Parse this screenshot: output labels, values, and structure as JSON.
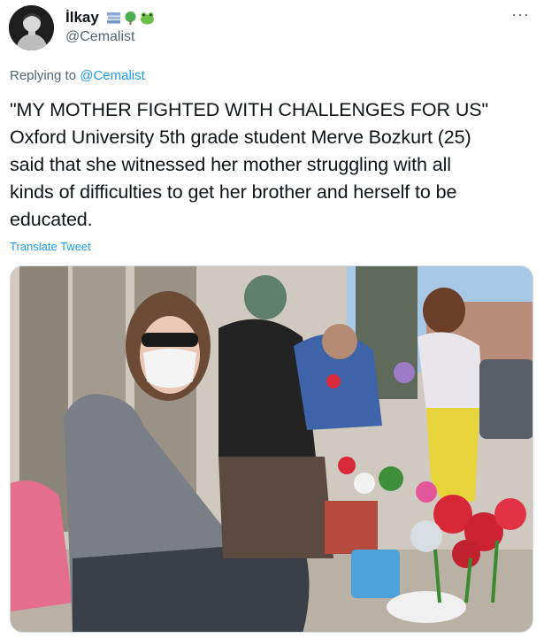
{
  "author": {
    "display_name": "İlkay",
    "handle": "@Cemalist",
    "emojis": [
      "books-emoji",
      "tree-emoji",
      "frog-emoji"
    ]
  },
  "reply": {
    "prefix": "Replying to",
    "mention": "@Cemalist"
  },
  "tweet": {
    "text_line1": "\"MY MOTHER FIGHTED WITH CHALLENGES FOR US\"",
    "text_line2": "Oxford University 5th grade student Merve Bozkurt (25)",
    "text_line3": "said that she witnessed her mother struggling with all",
    "text_line4": "kinds of difficulties to get her brother and herself to be",
    "text_line5": "educated.",
    "translate_label": "Translate Tweet",
    "more_label": "···"
  },
  "colors": {
    "link": "#1d9bf0",
    "secondary_text": "#536471",
    "primary_text": "#0f1419"
  }
}
